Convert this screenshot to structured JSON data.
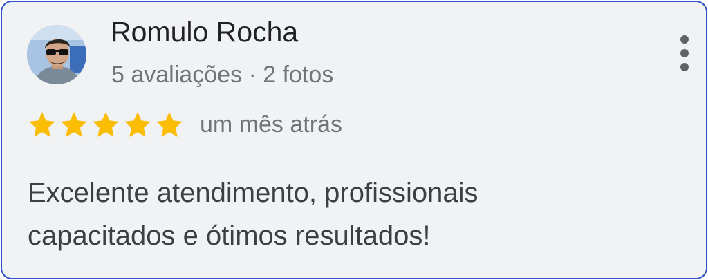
{
  "review": {
    "author": "Romulo Rocha",
    "meta": "5 avaliações · 2 fotos",
    "rating": 5,
    "rating_max": 5,
    "time": "um mês atrás",
    "text_line1": "Excelente atendimento, profissionais",
    "text_line2": "capacitados e ótimos resultados!"
  },
  "colors": {
    "card_border": "#2d52c9",
    "card_background": "#f1f2f4",
    "star": "#fbbc04",
    "name": "#202124",
    "secondary_text": "#70757a"
  },
  "icons": {
    "menu": "more-vertical-icon",
    "star": "star-icon"
  }
}
